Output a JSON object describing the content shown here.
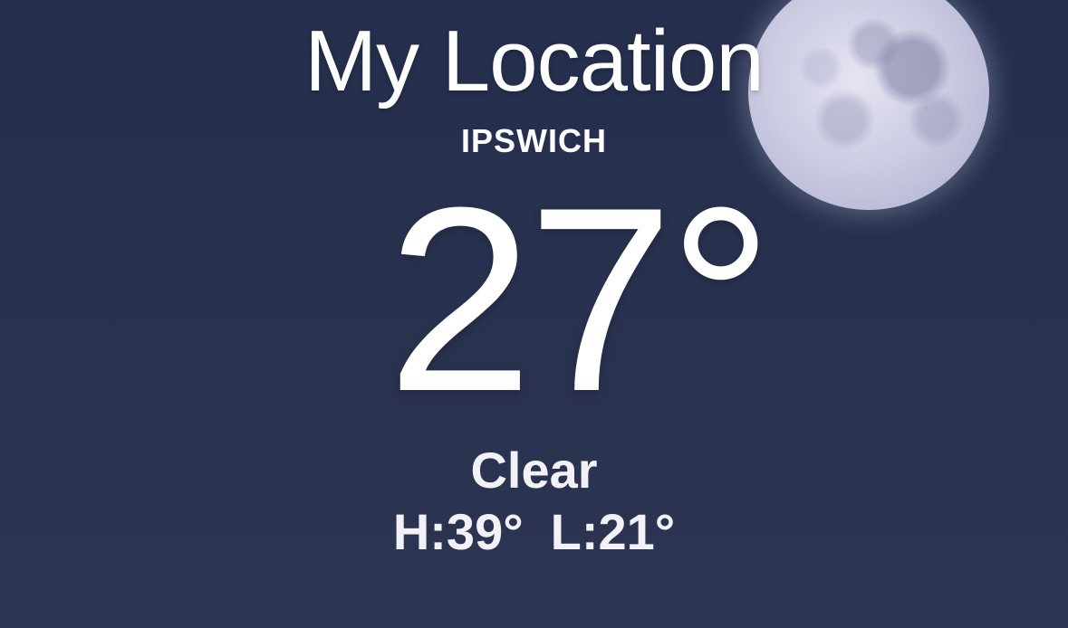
{
  "location": {
    "title": "My Location",
    "city": "IPSWICH"
  },
  "current": {
    "temperature": "27°",
    "condition": "Clear",
    "high": "H:39°",
    "low": "L:21°"
  },
  "background": {
    "scene": "night-clear",
    "icon": "moon-icon",
    "sky_color": "#29324f"
  }
}
